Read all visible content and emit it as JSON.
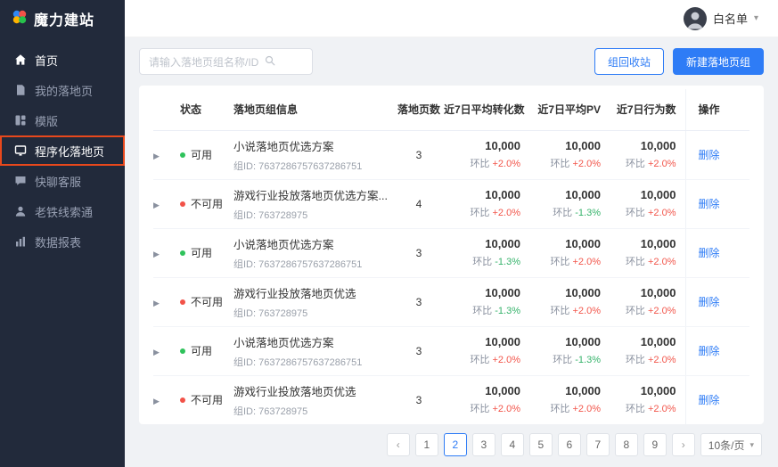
{
  "app": {
    "logo_text": "魔力建站",
    "topbar": {
      "username": "白名单"
    }
  },
  "icons": {
    "dropdown_caret": "▾",
    "expand_arrow": "▶",
    "prev": "‹",
    "next": "›"
  },
  "sidebar": {
    "items": [
      {
        "label": "首页"
      },
      {
        "label": "我的落地页"
      },
      {
        "label": "模版"
      },
      {
        "label": "程序化落地页"
      },
      {
        "label": "快聊客服"
      },
      {
        "label": "老铁线索通"
      },
      {
        "label": "数据报表"
      }
    ],
    "active_item": "程序化落地页"
  },
  "toolbar": {
    "search_placeholder": "请输入落地页组名称/ID",
    "recycle_button_label": "组回收站",
    "create_button_label": "新建落地页组"
  },
  "table": {
    "headers": {
      "status": "状态",
      "info": "落地页组信息",
      "pages": "落地页数",
      "conversions": "近7日平均转化数",
      "pv": "近7日平均PV",
      "behaviors": "近7日行为数",
      "actions": "操作"
    },
    "labels": {
      "group_id_prefix": "组ID: ",
      "ratio": "环比",
      "delete": "删除"
    },
    "rows": [
      {
        "status": "可用",
        "status_color": "green",
        "name": "小说落地页优选方案",
        "group_id": "7637286757637286751",
        "pages": "3",
        "conv": {
          "value": "10,000",
          "ratio": "+2.0%",
          "trend": "up"
        },
        "pv": {
          "value": "10,000",
          "ratio": "+2.0%",
          "trend": "up"
        },
        "beh": {
          "value": "10,000",
          "ratio": "+2.0%",
          "trend": "up"
        }
      },
      {
        "status": "不可用",
        "status_color": "red",
        "name": "游戏行业投放落地页优选方案...",
        "group_id": "763728975",
        "pages": "4",
        "conv": {
          "value": "10,000",
          "ratio": "+2.0%",
          "trend": "up"
        },
        "pv": {
          "value": "10,000",
          "ratio": "-1.3%",
          "trend": "down"
        },
        "beh": {
          "value": "10,000",
          "ratio": "+2.0%",
          "trend": "up"
        }
      },
      {
        "status": "可用",
        "status_color": "green",
        "name": "小说落地页优选方案",
        "group_id": "7637286757637286751",
        "pages": "3",
        "conv": {
          "value": "10,000",
          "ratio": "-1.3%",
          "trend": "down"
        },
        "pv": {
          "value": "10,000",
          "ratio": "+2.0%",
          "trend": "up"
        },
        "beh": {
          "value": "10,000",
          "ratio": "+2.0%",
          "trend": "up"
        }
      },
      {
        "status": "不可用",
        "status_color": "red",
        "name": "游戏行业投放落地页优选",
        "group_id": "763728975",
        "pages": "3",
        "conv": {
          "value": "10,000",
          "ratio": "-1.3%",
          "trend": "down"
        },
        "pv": {
          "value": "10,000",
          "ratio": "+2.0%",
          "trend": "up"
        },
        "beh": {
          "value": "10,000",
          "ratio": "+2.0%",
          "trend": "up"
        }
      },
      {
        "status": "可用",
        "status_color": "green",
        "name": "小说落地页优选方案",
        "group_id": "7637286757637286751",
        "pages": "3",
        "conv": {
          "value": "10,000",
          "ratio": "+2.0%",
          "trend": "up"
        },
        "pv": {
          "value": "10,000",
          "ratio": "-1.3%",
          "trend": "down"
        },
        "beh": {
          "value": "10,000",
          "ratio": "+2.0%",
          "trend": "up"
        }
      },
      {
        "status": "不可用",
        "status_color": "red",
        "name": "游戏行业投放落地页优选",
        "group_id": "763728975",
        "pages": "3",
        "conv": {
          "value": "10,000",
          "ratio": "+2.0%",
          "trend": "up"
        },
        "pv": {
          "value": "10,000",
          "ratio": "+2.0%",
          "trend": "up"
        },
        "beh": {
          "value": "10,000",
          "ratio": "+2.0%",
          "trend": "up"
        }
      }
    ]
  },
  "pagination": {
    "pages": [
      "1",
      "2",
      "3",
      "4",
      "5",
      "6",
      "7",
      "8",
      "9"
    ],
    "current": "2",
    "page_size_label": "10条/页"
  },
  "colors": {
    "primary": "#2e7cf6",
    "sidebar_bg": "#222a3b",
    "annotation_box": "#e8481c",
    "ratio_up_red": "#f2564b",
    "ratio_down_green": "#36b36b",
    "status_green": "#2fc25b",
    "status_red": "#f25248"
  }
}
